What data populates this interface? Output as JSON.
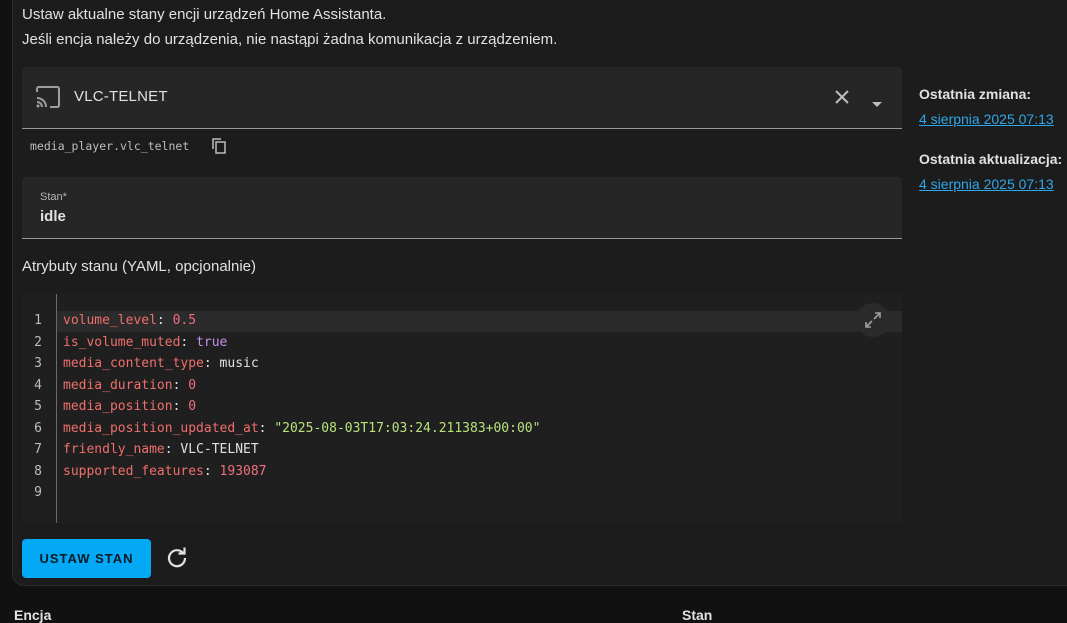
{
  "description": {
    "line1": "Ustaw aktualne stany encji urządzeń Home Assistanta.",
    "line2": "Jeśli encja należy do urządzenia, nie nastąpi żadna komunikacja z urządzeniem."
  },
  "entity_picker": {
    "icon": "cast-icon",
    "name": "VLC-TELNET",
    "clear_icon": "close-icon",
    "dropdown_icon": "arrow-drop-down-icon"
  },
  "entity_id": "media_player.vlc_telnet",
  "state_field": {
    "label": "Stan*",
    "value": "idle"
  },
  "attributes": {
    "title": "Atrybuty stanu (YAML, opcjonalnie)",
    "line_numbers": [
      "1",
      "2",
      "3",
      "4",
      "5",
      "6",
      "7",
      "8",
      "9"
    ],
    "lines": [
      {
        "key": "volume_level",
        "sep": ": ",
        "value": "0.5"
      },
      {
        "key": "is_volume_muted",
        "sep": ": ",
        "value": "true"
      },
      {
        "key": "media_content_type",
        "sep": ": ",
        "value": "music"
      },
      {
        "key": "media_duration",
        "sep": ": ",
        "value": "0"
      },
      {
        "key": "media_position",
        "sep": ": ",
        "value": "0"
      },
      {
        "key": "media_position_updated_at",
        "sep": ": ",
        "value": "\"2025-08-03T17:03:24.211383+00:00\""
      },
      {
        "key": "friendly_name",
        "sep": ": ",
        "value": "VLC-TELNET"
      },
      {
        "key": "supported_features",
        "sep": ": ",
        "value": "193087"
      }
    ]
  },
  "actions": {
    "set_state_label": "USTAW STAN",
    "refresh_icon": "refresh-icon"
  },
  "sidebar": {
    "last_changed_label": "Ostatnia zmiana:",
    "last_changed_value": "4 sierpnia 2025 07:13",
    "last_updated_label": "Ostatnia aktualizacja:",
    "last_updated_value": "4 sierpnia 2025 07:13"
  },
  "table_headers": {
    "entity": "Encja",
    "state": "Stan"
  },
  "colors": {
    "accent": "#03a9f4",
    "link": "#2fa6e8",
    "yaml_key": "#ef6f6c",
    "yaml_number": "#f26d7d",
    "yaml_bool": "#c68fe8",
    "yaml_string": "#b7e27d"
  }
}
